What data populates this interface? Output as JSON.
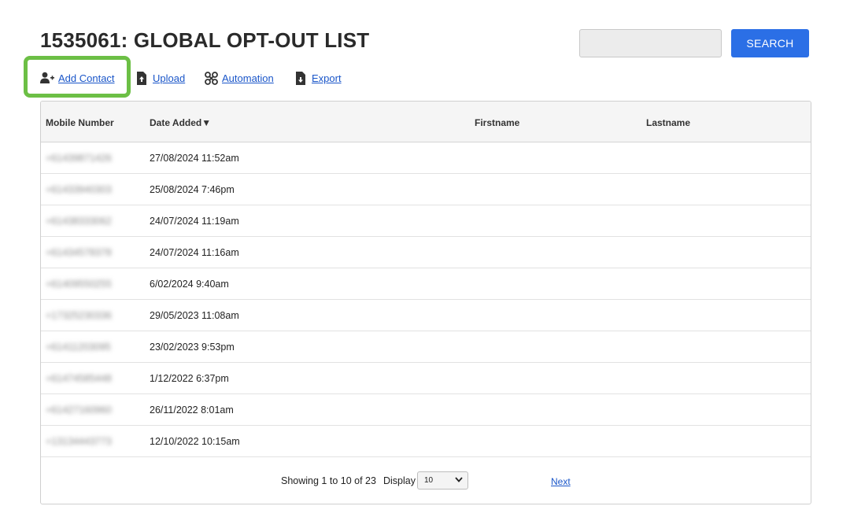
{
  "page": {
    "title": "1535061: GLOBAL OPT-OUT LIST"
  },
  "search": {
    "placeholder": "",
    "value": "",
    "button_label": "SEARCH"
  },
  "actions": [
    {
      "label": "Add Contact",
      "icon": "add-user-icon"
    },
    {
      "label": "Upload",
      "icon": "upload-file-icon"
    },
    {
      "label": "Automation",
      "icon": "automation-icon"
    },
    {
      "label": "Export",
      "icon": "export-file-icon"
    }
  ],
  "table": {
    "columns": [
      "Mobile Number",
      "Date Added▼",
      "Firstname",
      "Lastname"
    ],
    "rows": [
      {
        "mobile": "+61439871426",
        "date": "27/08/2024 11:52am",
        "firstname": "",
        "lastname": ""
      },
      {
        "mobile": "+61433940303",
        "date": "25/08/2024 7:46pm",
        "firstname": "",
        "lastname": ""
      },
      {
        "mobile": "+61438333062",
        "date": "24/07/2024 11:19am",
        "firstname": "",
        "lastname": ""
      },
      {
        "mobile": "+61434578378",
        "date": "24/07/2024 11:16am",
        "firstname": "",
        "lastname": ""
      },
      {
        "mobile": "+61409550255",
        "date": "6/02/2024 9:40am",
        "firstname": "",
        "lastname": ""
      },
      {
        "mobile": "+17325230336",
        "date": "29/05/2023 11:08am",
        "firstname": "",
        "lastname": ""
      },
      {
        "mobile": "+61411203095",
        "date": "23/02/2023 9:53pm",
        "firstname": "",
        "lastname": ""
      },
      {
        "mobile": "+61474585448",
        "date": "1/12/2022 6:37pm",
        "firstname": "",
        "lastname": ""
      },
      {
        "mobile": "+61427160960",
        "date": "26/11/2022 8:01am",
        "firstname": "",
        "lastname": ""
      },
      {
        "mobile": "+13134443773",
        "date": "12/10/2022 10:15am",
        "firstname": "",
        "lastname": ""
      }
    ]
  },
  "pagination": {
    "showing_text": "Showing 1 to 10 of 23",
    "display_label": "Display",
    "display_value": "10",
    "next_label": "Next"
  },
  "colors": {
    "accent": "#2b6fe6",
    "link": "#1a56c9",
    "highlight": "#6cbf45"
  }
}
